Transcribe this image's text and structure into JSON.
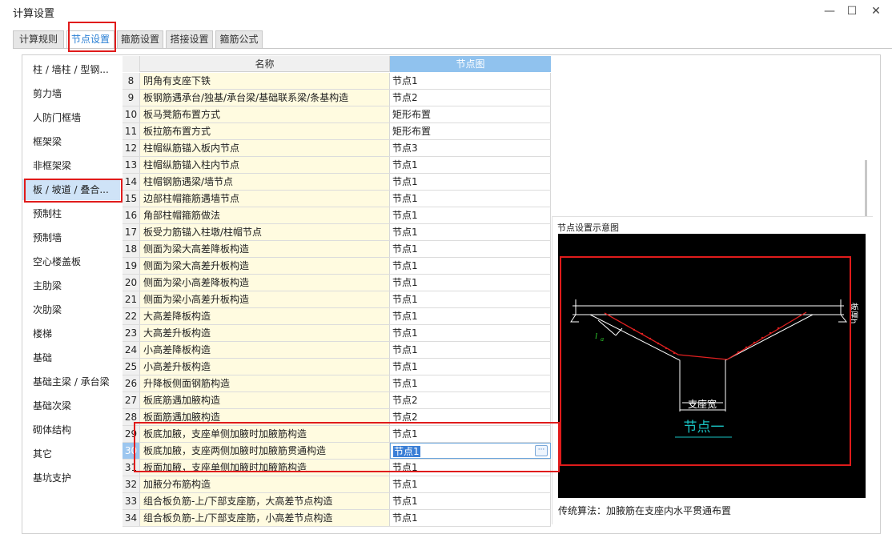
{
  "window": {
    "title": "计算设置",
    "minimize_glyph": "—",
    "maximize_glyph": "☐",
    "close_glyph": "✕"
  },
  "tabs": [
    {
      "label": "计算规则",
      "active": false
    },
    {
      "label": "节点设置",
      "active": true
    },
    {
      "label": "箍筋设置",
      "active": false
    },
    {
      "label": "搭接设置",
      "active": false
    },
    {
      "label": "箍筋公式",
      "active": false
    }
  ],
  "sidebar": {
    "selected_index": 5,
    "items": [
      "柱 / 墙柱 / 型钢...",
      "剪力墙",
      "人防门框墙",
      "框架梁",
      "非框架梁",
      "板 / 坡道 / 叠合...",
      "预制柱",
      "预制墙",
      "空心楼盖板",
      "主肋梁",
      "次肋梁",
      "楼梯",
      "基础",
      "基础主梁 / 承台梁",
      "基础次梁",
      "砌体结构",
      "其它",
      "基坑支护"
    ]
  },
  "grid": {
    "col_name": "名称",
    "col_node": "节点图",
    "selected_number": "30",
    "rows": [
      {
        "num": "8",
        "name": "阴角有支座下铁",
        "node": "节点1"
      },
      {
        "num": "9",
        "name": "板钢筋遇承台/独基/承台梁/基础联系梁/条基构造",
        "node": "节点2"
      },
      {
        "num": "10",
        "name": "板马凳筋布置方式",
        "node": "矩形布置"
      },
      {
        "num": "11",
        "name": "板拉筋布置方式",
        "node": "矩形布置"
      },
      {
        "num": "12",
        "name": "柱帽纵筋锚入板内节点",
        "node": "节点3"
      },
      {
        "num": "13",
        "name": "柱帽纵筋锚入柱内节点",
        "node": "节点1"
      },
      {
        "num": "14",
        "name": "柱帽钢筋遇梁/墙节点",
        "node": "节点1"
      },
      {
        "num": "15",
        "name": "边部柱帽箍筋遇墙节点",
        "node": "节点1"
      },
      {
        "num": "16",
        "name": "角部柱帽箍筋做法",
        "node": "节点1"
      },
      {
        "num": "17",
        "name": "板受力筋锚入柱墩/柱帽节点",
        "node": "节点1"
      },
      {
        "num": "18",
        "name": "侧面为梁大高差降板构造",
        "node": "节点1"
      },
      {
        "num": "19",
        "name": "侧面为梁大高差升板构造",
        "node": "节点1"
      },
      {
        "num": "20",
        "name": "侧面为梁小高差降板构造",
        "node": "节点1"
      },
      {
        "num": "21",
        "name": "侧面为梁小高差升板构造",
        "node": "节点1"
      },
      {
        "num": "22",
        "name": "大高差降板构造",
        "node": "节点1"
      },
      {
        "num": "23",
        "name": "大高差升板构造",
        "node": "节点1"
      },
      {
        "num": "24",
        "name": "小高差降板构造",
        "node": "节点1"
      },
      {
        "num": "25",
        "name": "小高差升板构造",
        "node": "节点1"
      },
      {
        "num": "26",
        "name": "升降板侧面钢筋构造",
        "node": "节点1"
      },
      {
        "num": "27",
        "name": "板底筋遇加腋构造",
        "node": "节点2"
      },
      {
        "num": "28",
        "name": "板面筋遇加腋构造",
        "node": "节点2"
      },
      {
        "num": "29",
        "name": "板底加腋，支座单侧加腋时加腋筋构造",
        "node": "节点1"
      },
      {
        "num": "30",
        "name": "板底加腋，支座两侧加腋时加腋筋贯通构造",
        "node": "节点1"
      },
      {
        "num": "31",
        "name": "板面加腋，支座单侧加腋时加腋筋构造",
        "node": "节点1"
      },
      {
        "num": "32",
        "name": "加腋分布筋构造",
        "node": "节点1"
      },
      {
        "num": "33",
        "name": "组合板负筋-上/下部支座筋，大高差节点构造",
        "node": "节点1"
      },
      {
        "num": "34",
        "name": "组合板负筋-上/下部支座筋，小高差节点构造",
        "node": "节点1"
      }
    ]
  },
  "preview": {
    "title": "节点设置示意图",
    "diagram_label_la": "l",
    "diagram_label_a": "a",
    "diagram_label_support": "支座宽",
    "diagram_label_node": "节点一",
    "diagram_label_side": "板厚h",
    "caption": "传统算法：加腋筋在支座内水平贯通布置"
  },
  "colors": {
    "accent": "#2a7fd4",
    "highlight_red": "#e01b1b",
    "name_cell_bg": "#fffbe0",
    "diagram_bg": "#000000",
    "diagram_rebar": "#e02020",
    "diagram_label": "#19c2c2"
  }
}
